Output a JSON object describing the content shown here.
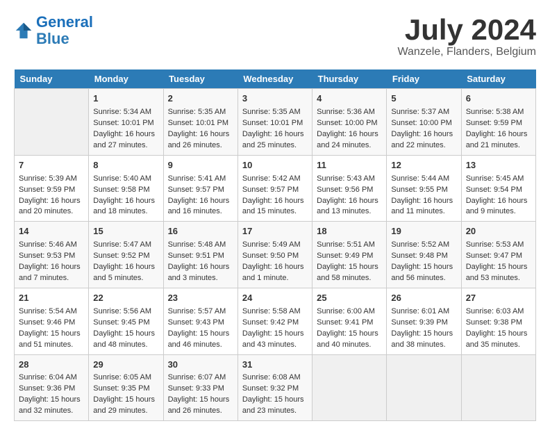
{
  "header": {
    "logo_line1": "General",
    "logo_line2": "Blue",
    "month": "July 2024",
    "location": "Wanzele, Flanders, Belgium"
  },
  "columns": [
    "Sunday",
    "Monday",
    "Tuesday",
    "Wednesday",
    "Thursday",
    "Friday",
    "Saturday"
  ],
  "weeks": [
    [
      {
        "day": "",
        "empty": true
      },
      {
        "day": "1",
        "sunrise": "Sunrise: 5:34 AM",
        "sunset": "Sunset: 10:01 PM",
        "daylight": "Daylight: 16 hours and 27 minutes."
      },
      {
        "day": "2",
        "sunrise": "Sunrise: 5:35 AM",
        "sunset": "Sunset: 10:01 PM",
        "daylight": "Daylight: 16 hours and 26 minutes."
      },
      {
        "day": "3",
        "sunrise": "Sunrise: 5:35 AM",
        "sunset": "Sunset: 10:01 PM",
        "daylight": "Daylight: 16 hours and 25 minutes."
      },
      {
        "day": "4",
        "sunrise": "Sunrise: 5:36 AM",
        "sunset": "Sunset: 10:00 PM",
        "daylight": "Daylight: 16 hours and 24 minutes."
      },
      {
        "day": "5",
        "sunrise": "Sunrise: 5:37 AM",
        "sunset": "Sunset: 10:00 PM",
        "daylight": "Daylight: 16 hours and 22 minutes."
      },
      {
        "day": "6",
        "sunrise": "Sunrise: 5:38 AM",
        "sunset": "Sunset: 9:59 PM",
        "daylight": "Daylight: 16 hours and 21 minutes."
      }
    ],
    [
      {
        "day": "7",
        "sunrise": "Sunrise: 5:39 AM",
        "sunset": "Sunset: 9:59 PM",
        "daylight": "Daylight: 16 hours and 20 minutes."
      },
      {
        "day": "8",
        "sunrise": "Sunrise: 5:40 AM",
        "sunset": "Sunset: 9:58 PM",
        "daylight": "Daylight: 16 hours and 18 minutes."
      },
      {
        "day": "9",
        "sunrise": "Sunrise: 5:41 AM",
        "sunset": "Sunset: 9:57 PM",
        "daylight": "Daylight: 16 hours and 16 minutes."
      },
      {
        "day": "10",
        "sunrise": "Sunrise: 5:42 AM",
        "sunset": "Sunset: 9:57 PM",
        "daylight": "Daylight: 16 hours and 15 minutes."
      },
      {
        "day": "11",
        "sunrise": "Sunrise: 5:43 AM",
        "sunset": "Sunset: 9:56 PM",
        "daylight": "Daylight: 16 hours and 13 minutes."
      },
      {
        "day": "12",
        "sunrise": "Sunrise: 5:44 AM",
        "sunset": "Sunset: 9:55 PM",
        "daylight": "Daylight: 16 hours and 11 minutes."
      },
      {
        "day": "13",
        "sunrise": "Sunrise: 5:45 AM",
        "sunset": "Sunset: 9:54 PM",
        "daylight": "Daylight: 16 hours and 9 minutes."
      }
    ],
    [
      {
        "day": "14",
        "sunrise": "Sunrise: 5:46 AM",
        "sunset": "Sunset: 9:53 PM",
        "daylight": "Daylight: 16 hours and 7 minutes."
      },
      {
        "day": "15",
        "sunrise": "Sunrise: 5:47 AM",
        "sunset": "Sunset: 9:52 PM",
        "daylight": "Daylight: 16 hours and 5 minutes."
      },
      {
        "day": "16",
        "sunrise": "Sunrise: 5:48 AM",
        "sunset": "Sunset: 9:51 PM",
        "daylight": "Daylight: 16 hours and 3 minutes."
      },
      {
        "day": "17",
        "sunrise": "Sunrise: 5:49 AM",
        "sunset": "Sunset: 9:50 PM",
        "daylight": "Daylight: 16 hours and 1 minute."
      },
      {
        "day": "18",
        "sunrise": "Sunrise: 5:51 AM",
        "sunset": "Sunset: 9:49 PM",
        "daylight": "Daylight: 15 hours and 58 minutes."
      },
      {
        "day": "19",
        "sunrise": "Sunrise: 5:52 AM",
        "sunset": "Sunset: 9:48 PM",
        "daylight": "Daylight: 15 hours and 56 minutes."
      },
      {
        "day": "20",
        "sunrise": "Sunrise: 5:53 AM",
        "sunset": "Sunset: 9:47 PM",
        "daylight": "Daylight: 15 hours and 53 minutes."
      }
    ],
    [
      {
        "day": "21",
        "sunrise": "Sunrise: 5:54 AM",
        "sunset": "Sunset: 9:46 PM",
        "daylight": "Daylight: 15 hours and 51 minutes."
      },
      {
        "day": "22",
        "sunrise": "Sunrise: 5:56 AM",
        "sunset": "Sunset: 9:45 PM",
        "daylight": "Daylight: 15 hours and 48 minutes."
      },
      {
        "day": "23",
        "sunrise": "Sunrise: 5:57 AM",
        "sunset": "Sunset: 9:43 PM",
        "daylight": "Daylight: 15 hours and 46 minutes."
      },
      {
        "day": "24",
        "sunrise": "Sunrise: 5:58 AM",
        "sunset": "Sunset: 9:42 PM",
        "daylight": "Daylight: 15 hours and 43 minutes."
      },
      {
        "day": "25",
        "sunrise": "Sunrise: 6:00 AM",
        "sunset": "Sunset: 9:41 PM",
        "daylight": "Daylight: 15 hours and 40 minutes."
      },
      {
        "day": "26",
        "sunrise": "Sunrise: 6:01 AM",
        "sunset": "Sunset: 9:39 PM",
        "daylight": "Daylight: 15 hours and 38 minutes."
      },
      {
        "day": "27",
        "sunrise": "Sunrise: 6:03 AM",
        "sunset": "Sunset: 9:38 PM",
        "daylight": "Daylight: 15 hours and 35 minutes."
      }
    ],
    [
      {
        "day": "28",
        "sunrise": "Sunrise: 6:04 AM",
        "sunset": "Sunset: 9:36 PM",
        "daylight": "Daylight: 15 hours and 32 minutes."
      },
      {
        "day": "29",
        "sunrise": "Sunrise: 6:05 AM",
        "sunset": "Sunset: 9:35 PM",
        "daylight": "Daylight: 15 hours and 29 minutes."
      },
      {
        "day": "30",
        "sunrise": "Sunrise: 6:07 AM",
        "sunset": "Sunset: 9:33 PM",
        "daylight": "Daylight: 15 hours and 26 minutes."
      },
      {
        "day": "31",
        "sunrise": "Sunrise: 6:08 AM",
        "sunset": "Sunset: 9:32 PM",
        "daylight": "Daylight: 15 hours and 23 minutes."
      },
      {
        "day": "",
        "empty": true
      },
      {
        "day": "",
        "empty": true
      },
      {
        "day": "",
        "empty": true
      }
    ]
  ]
}
